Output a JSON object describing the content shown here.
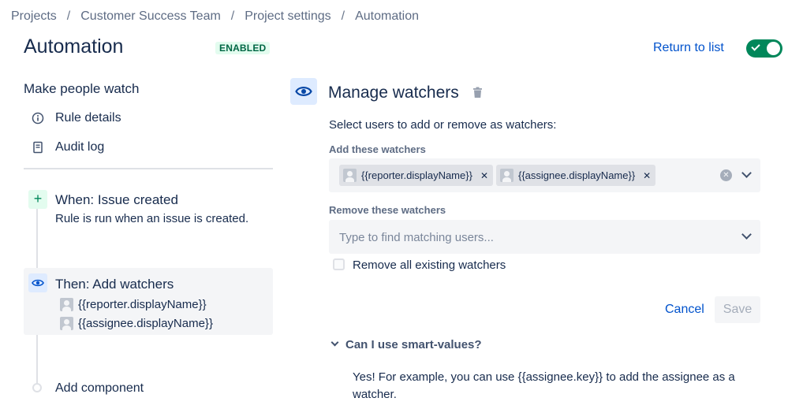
{
  "breadcrumb": {
    "items": [
      "Projects",
      "Customer Success Team",
      "Project settings",
      "Automation"
    ],
    "separator": "/"
  },
  "header": {
    "title": "Automation",
    "status": "ENABLED",
    "return_label": "Return to list",
    "toggle_on": true
  },
  "sidebar": {
    "rule_name": "Make people watch",
    "links": [
      {
        "label": "Rule details",
        "icon": "info-icon"
      },
      {
        "label": "Audit log",
        "icon": "document-icon"
      }
    ],
    "trigger": {
      "icon": "plus-icon",
      "title": "When: Issue created",
      "description": "Rule is run when an issue is created."
    },
    "action": {
      "icon": "eye-icon",
      "title": "Then: Add watchers",
      "users": [
        "{{reporter.displayName}}",
        "{{assignee.displayName}}"
      ]
    },
    "add_component": "Add component"
  },
  "editor": {
    "icon": "eye-icon",
    "title": "Manage watchers",
    "description": "Select users to add or remove as watchers:",
    "add_label": "Add these watchers",
    "add_values": [
      "{{reporter.displayName}}",
      "{{assignee.displayName}}"
    ],
    "remove_label": "Remove these watchers",
    "remove_placeholder": "Type to find matching users...",
    "remove_all_label": "Remove all existing watchers",
    "cancel_label": "Cancel",
    "save_label": "Save",
    "help_title": "Can I use smart-values?",
    "help_body": "Yes! For example, you can use {{assignee.key}} to add the assignee as a watcher."
  },
  "colors": {
    "accent": "#0052cc",
    "success": "#00875a",
    "text": "#172b4d"
  }
}
